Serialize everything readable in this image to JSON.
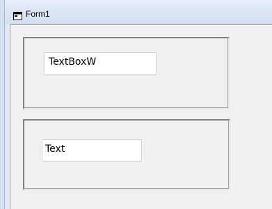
{
  "window": {
    "title": "Form1",
    "icon": "form-window-icon"
  },
  "panels": [
    {
      "textbox": {
        "value": "TextBoxW"
      }
    },
    {
      "textbox": {
        "value": "Text"
      }
    }
  ],
  "colors": {
    "titlebar": "#dbe5f4",
    "client_background": "#f0f0f0",
    "textbox_background": "#ffffff"
  }
}
